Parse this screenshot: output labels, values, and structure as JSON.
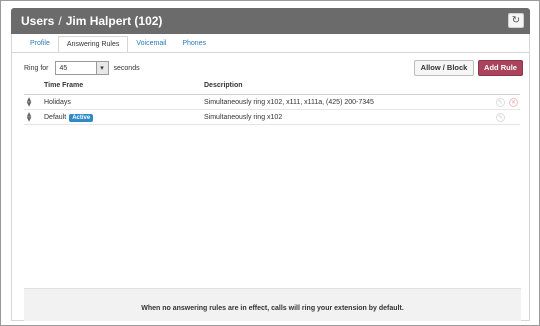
{
  "header": {
    "section": "Users",
    "separator": "/",
    "user": "Jim Halpert (102)",
    "refresh_icon": "refresh-icon"
  },
  "tabs": [
    {
      "label": "Profile",
      "active": false
    },
    {
      "label": "Answering Rules",
      "active": true
    },
    {
      "label": "Voicemail",
      "active": false
    },
    {
      "label": "Phones",
      "active": false
    }
  ],
  "ring": {
    "prefix": "Ring for",
    "value": "45",
    "suffix": "seconds"
  },
  "buttons": {
    "allow_block": "Allow / Block",
    "add_rule": "Add Rule"
  },
  "table": {
    "columns": [
      "Time Frame",
      "Description"
    ],
    "rows": [
      {
        "time_frame": "Holidays",
        "badge": "",
        "description": "Simultaneously ring x102, x111, x111a, (425) 200-7345"
      },
      {
        "time_frame": "Default",
        "badge": "Active",
        "description": "Simultaneously ring x102"
      }
    ]
  },
  "footer": {
    "message": "When no answering rules are in effect, calls will ring your extension by default."
  },
  "colors": {
    "header_bg": "#6b6b6b",
    "link": "#2a7ab8",
    "add_button": "#a8445c",
    "badge": "#2f8ac5"
  }
}
